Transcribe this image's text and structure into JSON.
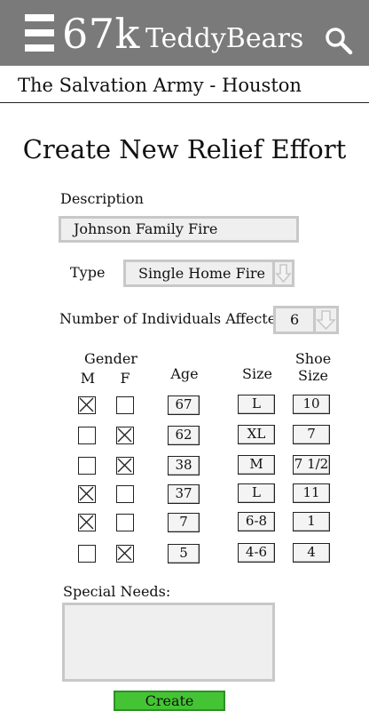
{
  "header": {
    "logo_number": "67k",
    "logo_name": "TeddyBears",
    "background": "#7a7a7a"
  },
  "organization": "The Salvation Army - Houston",
  "page_title": "Create New Relief Effort",
  "form": {
    "description_label": "Description",
    "description_value": "Johnson Family Fire",
    "type_label": "Type",
    "type_value": "Single Home Fire",
    "individuals_label": "Number of Individuals Affected",
    "individuals_value": "6",
    "columns": {
      "gender": "Gender",
      "male": "M",
      "female": "F",
      "age": "Age",
      "size": "Size",
      "shoe_line1": "Shoe",
      "shoe_line2": "Size"
    },
    "individuals": [
      {
        "gender": "M",
        "age": "67",
        "size": "L",
        "shoe": "10"
      },
      {
        "gender": "F",
        "age": "62",
        "size": "XL",
        "shoe": "7"
      },
      {
        "gender": "F",
        "age": "38",
        "size": "M",
        "shoe": "7 1/2"
      },
      {
        "gender": "M",
        "age": "37",
        "size": "L",
        "shoe": "11"
      },
      {
        "gender": "M",
        "age": "7",
        "size": "6-8",
        "shoe": "1"
      },
      {
        "gender": "F",
        "age": "5",
        "size": "4-6",
        "shoe": "4"
      }
    ],
    "special_needs_label": "Special Needs:",
    "special_needs_value": "",
    "create_label": "Create",
    "create_color": "#44c434"
  }
}
